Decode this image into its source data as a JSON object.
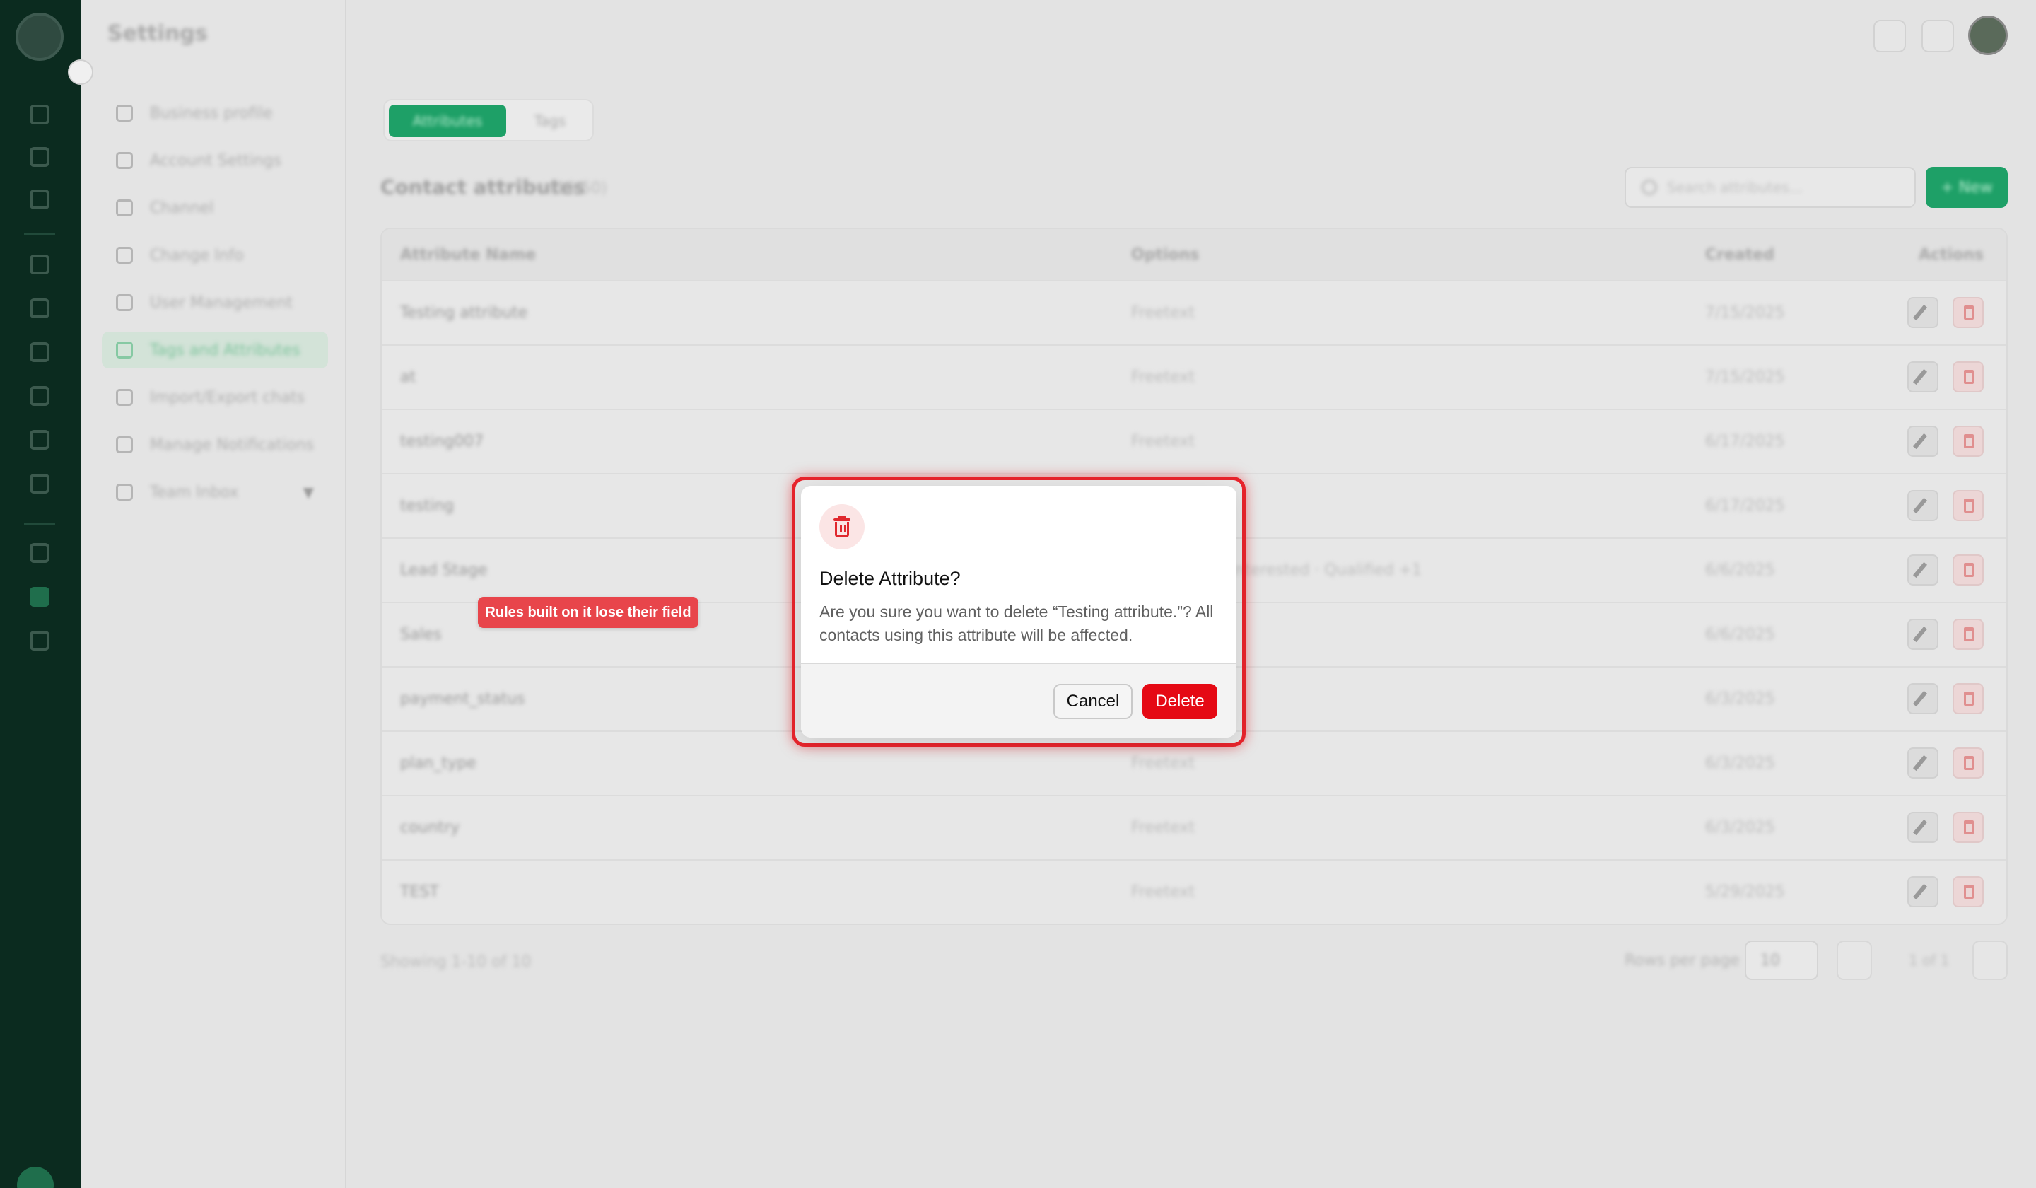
{
  "header": {
    "title": "Settings"
  },
  "sidebar": {
    "items": [
      {
        "label": "Business profile"
      },
      {
        "label": "Account Settings"
      },
      {
        "label": "Channel"
      },
      {
        "label": "Change Info"
      },
      {
        "label": "User Management"
      },
      {
        "label": "Tags and Attributes"
      },
      {
        "label": "Import/Export chats"
      },
      {
        "label": "Manage Notifications"
      },
      {
        "label": "Team Inbox"
      }
    ]
  },
  "main": {
    "tabs": [
      {
        "label": "Attributes"
      },
      {
        "label": "Tags"
      }
    ],
    "section_title": "Contact attributes",
    "section_count": "(10/50)",
    "search_placeholder": "Search attributes...",
    "new_button": "+ New",
    "table": {
      "headers": {
        "name": "Attribute Name",
        "options": "Options",
        "created": "Created",
        "actions": "Actions"
      },
      "rows": [
        {
          "name": "Testing attribute",
          "options": "Freetext",
          "created": "7/15/2025"
        },
        {
          "name": "at",
          "options": "Freetext",
          "created": "7/15/2025"
        },
        {
          "name": "testing007",
          "options": "Freetext",
          "created": "6/17/2025"
        },
        {
          "name": "testing",
          "options": "",
          "created": "6/17/2025"
        },
        {
          "name": "Lead Stage",
          "options": "Interested · Qualified +1",
          "created": "6/6/2025"
        },
        {
          "name": "Sales",
          "options": "",
          "created": "6/6/2025"
        },
        {
          "name": "payment_status",
          "options": "",
          "created": "6/3/2025"
        },
        {
          "name": "plan_type",
          "options": "Freetext",
          "created": "6/3/2025"
        },
        {
          "name": "country",
          "options": "Freetext",
          "created": "6/3/2025"
        },
        {
          "name": "TEST",
          "options": "Freetext",
          "created": "5/29/2025"
        }
      ]
    },
    "pagination": {
      "showing": "Showing 1-10 of 10",
      "rows_per_page_label": "Rows per page",
      "rows_per_page": "10",
      "page": "1 of 1"
    }
  },
  "dialog": {
    "title": "Delete Attribute?",
    "message": "Are you sure you want to delete “Testing attribute.”? All contacts using this attribute will be affected.",
    "cancel_label": "Cancel",
    "delete_label": "Delete"
  },
  "tooltip": {
    "text": "Rules built on it lose their field"
  },
  "colors": {
    "accent": "#1ea067",
    "danger": "#e50914",
    "rail": "#0b2b1f",
    "highlight": "#e8242c"
  }
}
